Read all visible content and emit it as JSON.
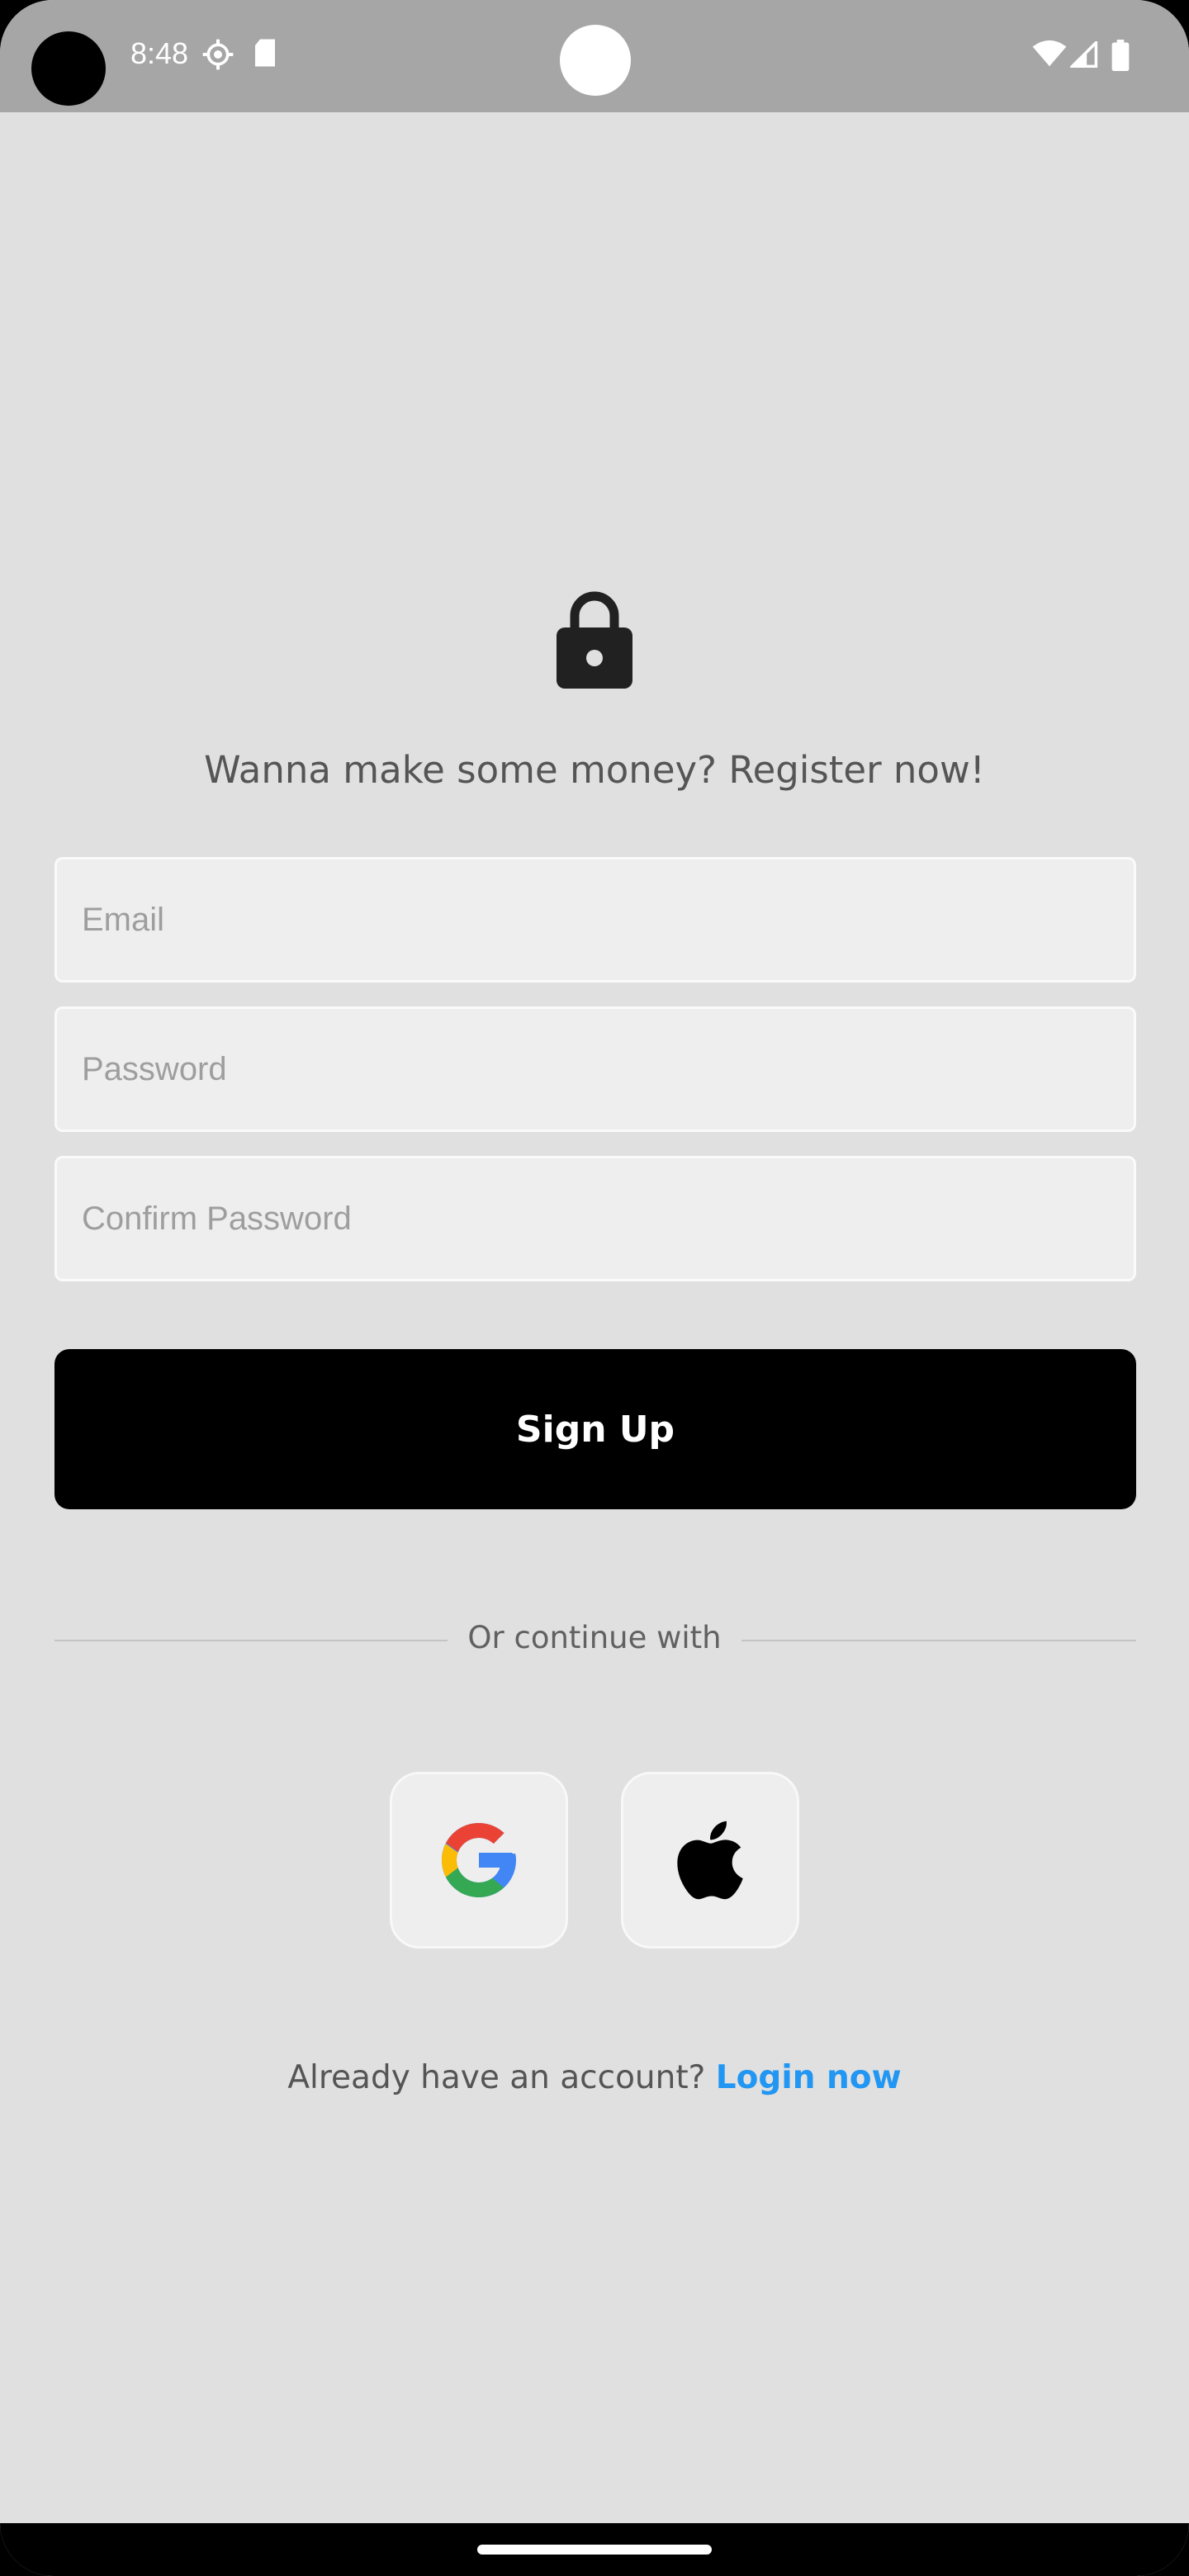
{
  "status_bar": {
    "time": "8:48",
    "icons_left": [
      "settings-icon",
      "sd-card-icon"
    ],
    "icons_right": [
      "wifi-icon",
      "cell-signal-icon",
      "battery-icon"
    ]
  },
  "header": {
    "icon": "lock-icon",
    "headline": "Wanna make some money? Register now!"
  },
  "form": {
    "email_placeholder": "Email",
    "email_value": "",
    "password_placeholder": "Password",
    "password_value": "",
    "confirm_password_placeholder": "Confirm Password",
    "confirm_password_value": "",
    "signup_label": "Sign Up"
  },
  "divider": {
    "label": "Or continue with"
  },
  "social": {
    "buttons": [
      {
        "name": "google",
        "icon": "google-icon"
      },
      {
        "name": "apple",
        "icon": "apple-icon"
      }
    ]
  },
  "footer": {
    "prompt": "Already have an account?",
    "link_label": "Login now"
  },
  "colors": {
    "background": "#e0e0e0",
    "status_bar": "#a6a6a6",
    "button": "#000000",
    "link": "#2196f3",
    "field_bg": "#eeeeee"
  }
}
